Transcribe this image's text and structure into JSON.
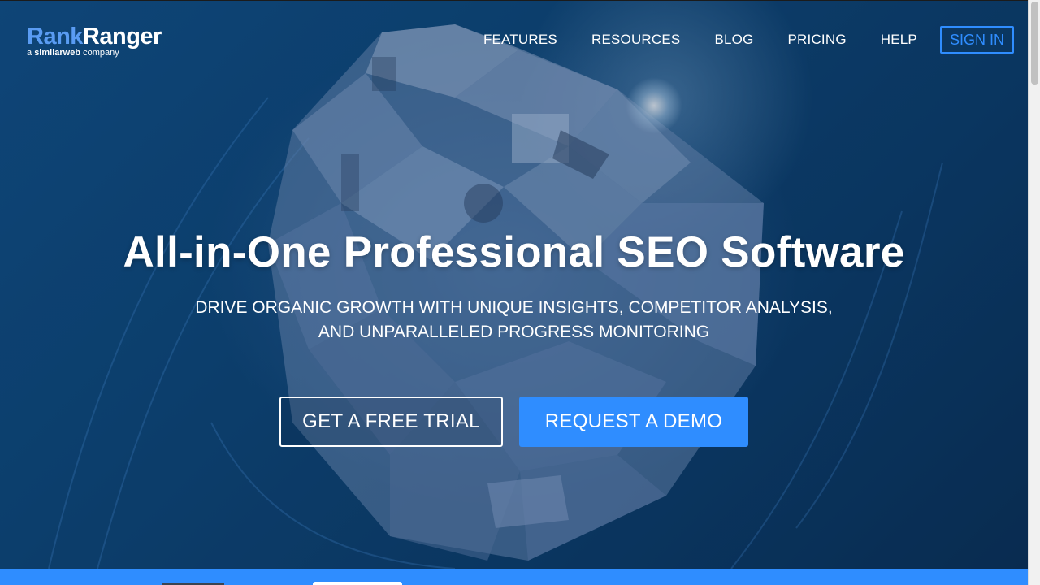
{
  "logo": {
    "rank": "Rank",
    "ranger": "Ranger",
    "sub_prefix": "a ",
    "sub_brand": "similarweb",
    "sub_suffix": " company"
  },
  "nav": {
    "items": [
      {
        "label": "FEATURES"
      },
      {
        "label": "RESOURCES"
      },
      {
        "label": "BLOG"
      },
      {
        "label": "PRICING"
      },
      {
        "label": "HELP"
      }
    ],
    "signin_label": "SIGN IN"
  },
  "hero": {
    "headline": "All-in-One Professional SEO Software",
    "subline_1": "DRIVE ORGANIC GROWTH WITH UNIQUE INSIGHTS, COMPETITOR ANALYSIS,",
    "subline_2": "AND UNPARALLELED PROGRESS MONITORING",
    "trial_label": "GET A FREE TRIAL",
    "demo_label": "REQUEST A DEMO"
  },
  "colors": {
    "accent": "#2f8dff",
    "logo_rank": "#5a9cf3",
    "hero_bg": "#0d4677"
  },
  "icons": {
    "hero_art": "cube-illustration"
  }
}
